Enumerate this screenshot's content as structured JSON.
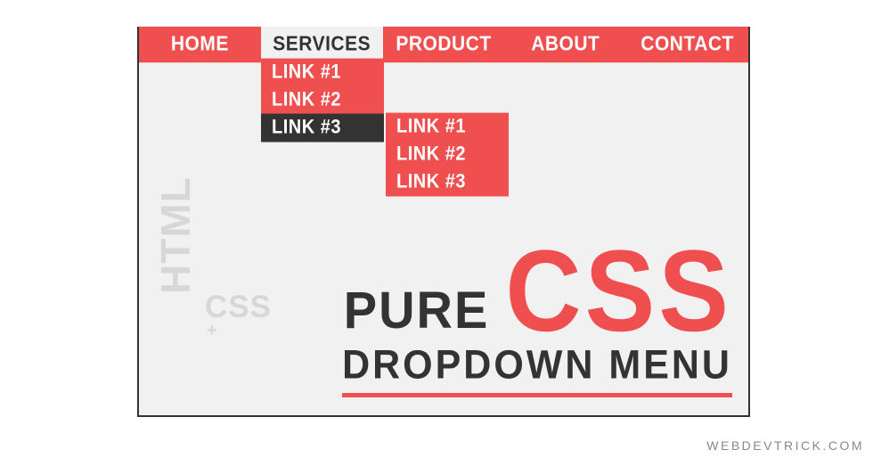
{
  "nav": {
    "items": [
      {
        "label": "HOME"
      },
      {
        "label": "SERVICES"
      },
      {
        "label": "PRODUCT"
      },
      {
        "label": "ABOUT"
      },
      {
        "label": "CONTACT"
      }
    ]
  },
  "dropdown": {
    "items": [
      {
        "label": "LINK #1"
      },
      {
        "label": "LINK #2"
      },
      {
        "label": "LINK #3"
      }
    ]
  },
  "subdropdown": {
    "items": [
      {
        "label": "LINK #1"
      },
      {
        "label": "LINK #2"
      },
      {
        "label": "LINK #3"
      }
    ]
  },
  "side": {
    "html": "HTML",
    "plus": "+",
    "css": "CSS"
  },
  "title": {
    "pure": "PURE",
    "css": "CSS",
    "line2": "DROPDOWN MENU"
  },
  "watermark": "WEBDEVTRICK.COM"
}
